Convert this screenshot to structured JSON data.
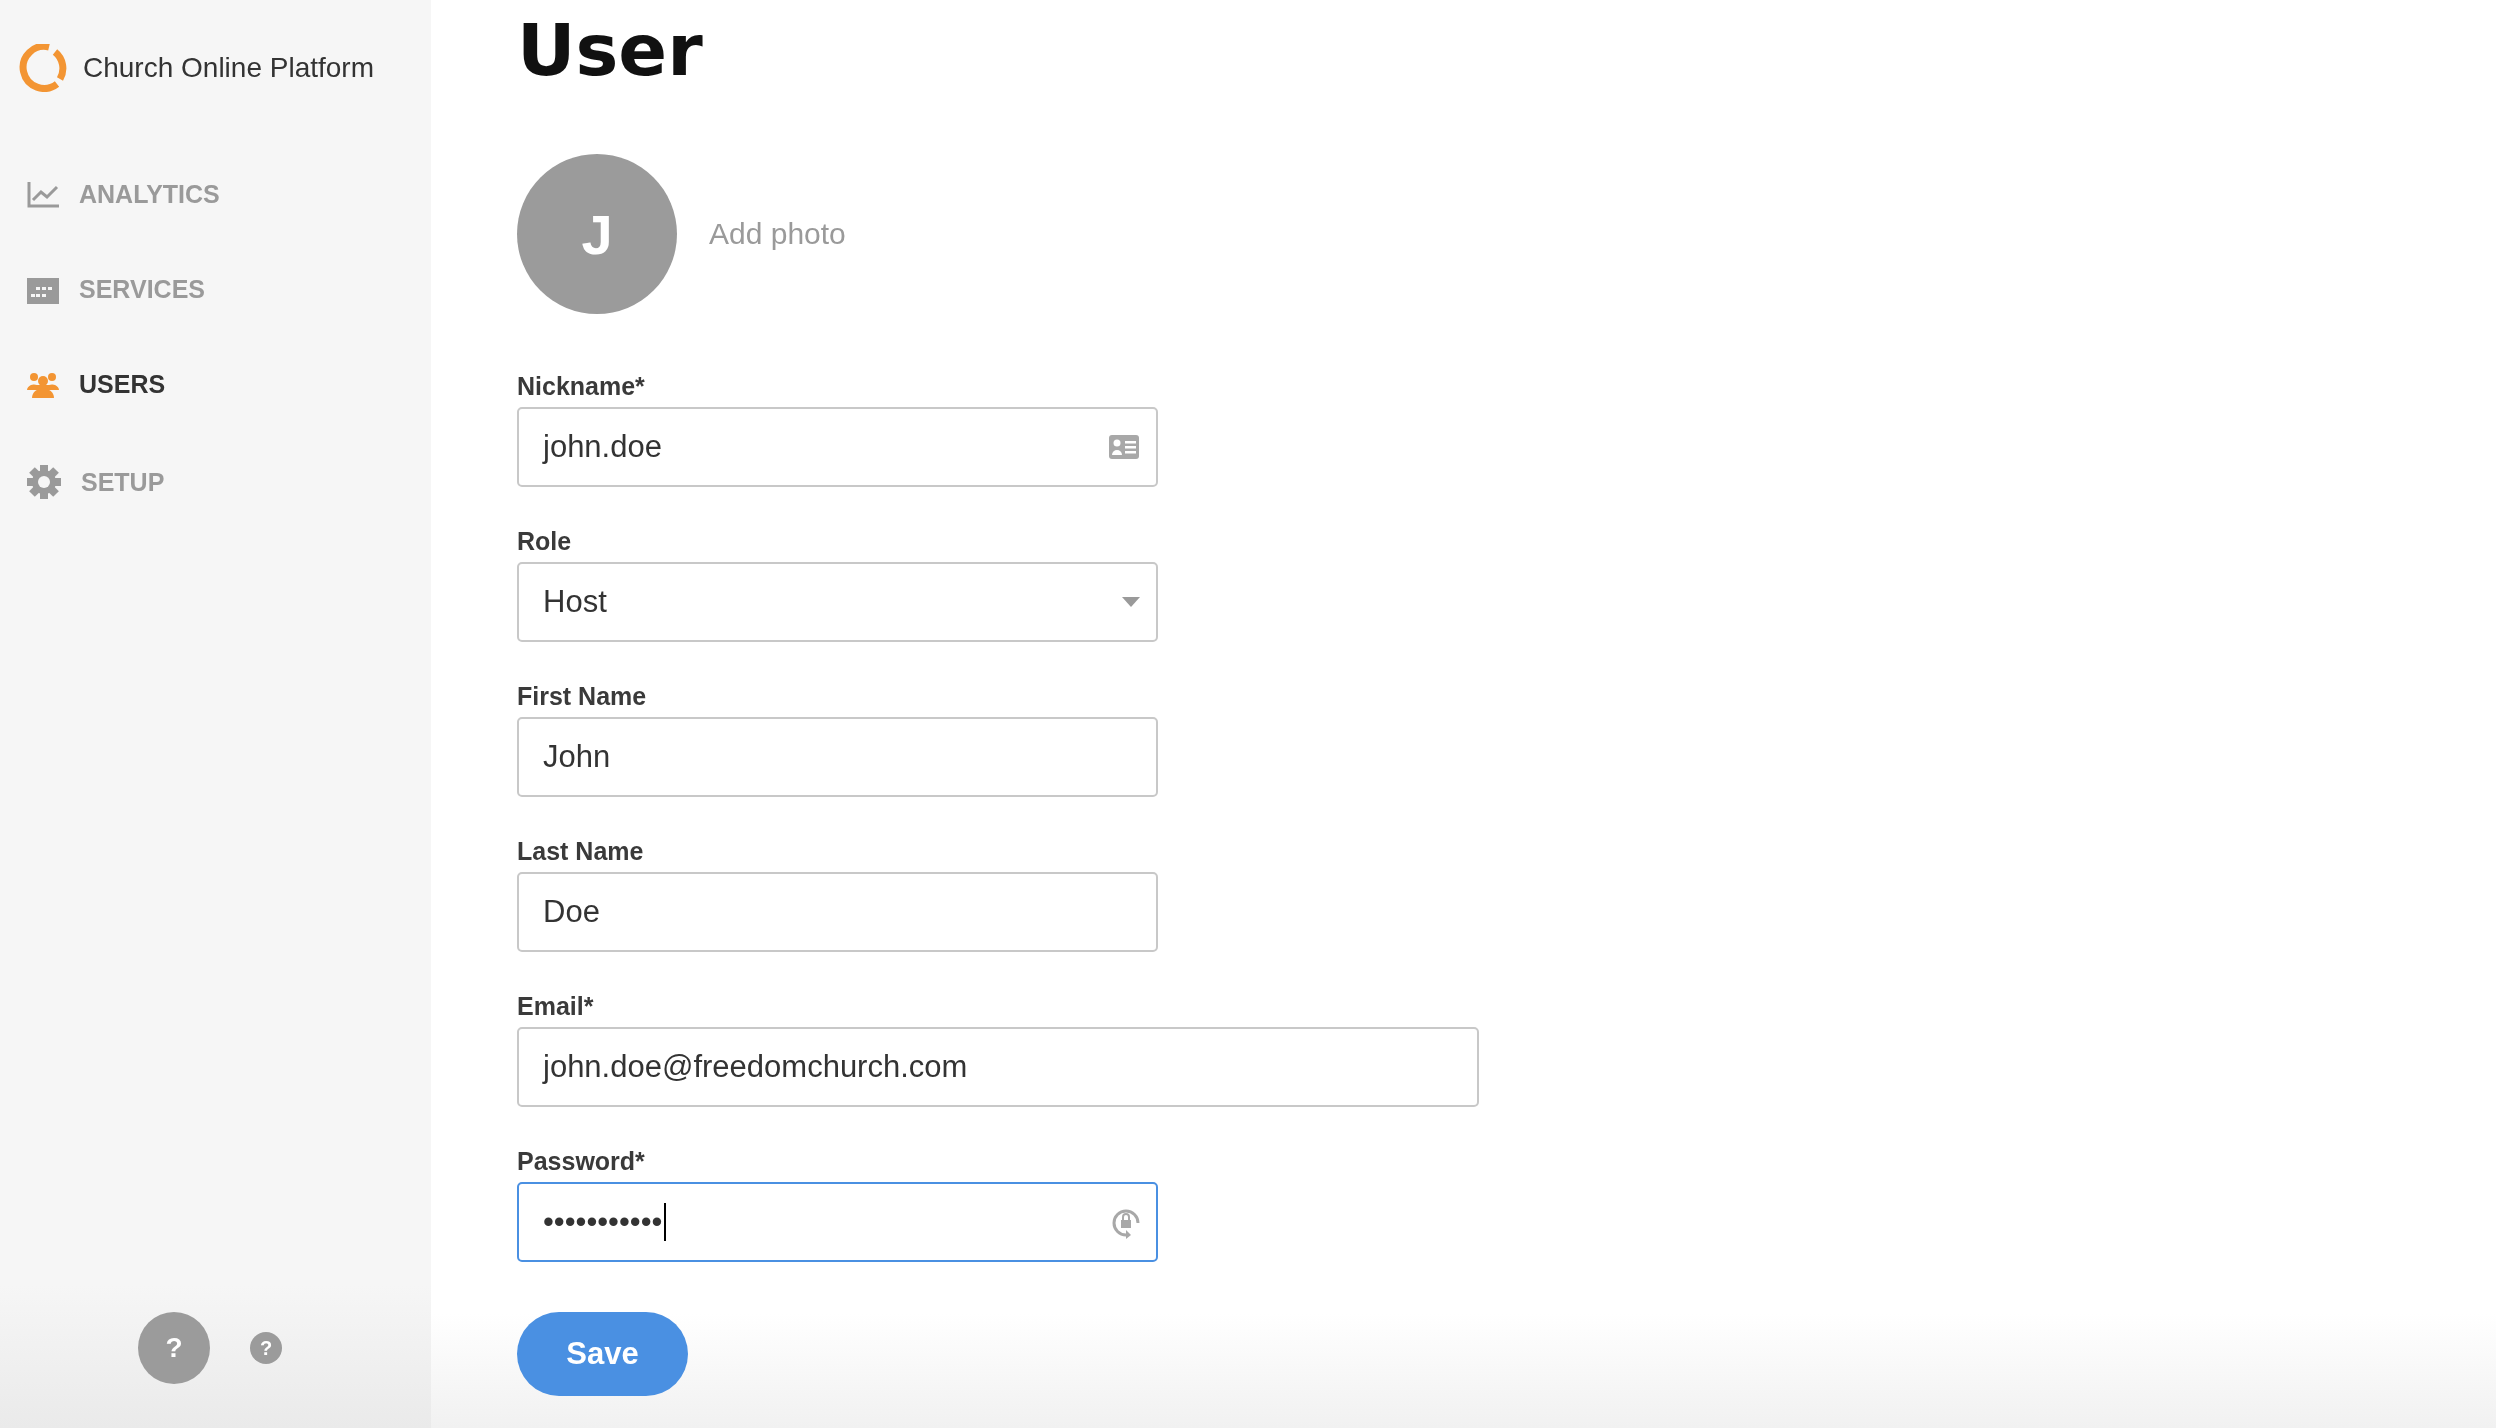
{
  "brand": {
    "name": "Church Online Platform"
  },
  "nav": [
    {
      "label": "ANALYTICS",
      "selected": false
    },
    {
      "label": "SERVICES",
      "selected": false
    },
    {
      "label": "USERS",
      "selected": true
    },
    {
      "label": "SETUP",
      "selected": false
    }
  ],
  "help": {
    "large": "?",
    "small": "?"
  },
  "page": {
    "title": "User",
    "avatar_initial": "J",
    "add_photo": "Add photo"
  },
  "fields": [
    {
      "label": "Nickname*",
      "kind": "nickname",
      "value": "john.doe",
      "focused": false
    },
    {
      "label": "Role",
      "kind": "select",
      "value": "Host",
      "focused": false
    },
    {
      "label": "First Name",
      "kind": "text",
      "value": "John",
      "focused": false
    },
    {
      "label": "Last Name",
      "kind": "text",
      "value": "Doe",
      "focused": false
    },
    {
      "label": "Email*",
      "kind": "email",
      "value": "john.doe@freedomchurch.com",
      "focused": false
    },
    {
      "label": "Password*",
      "kind": "password",
      "value": "•••••••••••",
      "focused": true
    }
  ],
  "save_button": "Save"
}
